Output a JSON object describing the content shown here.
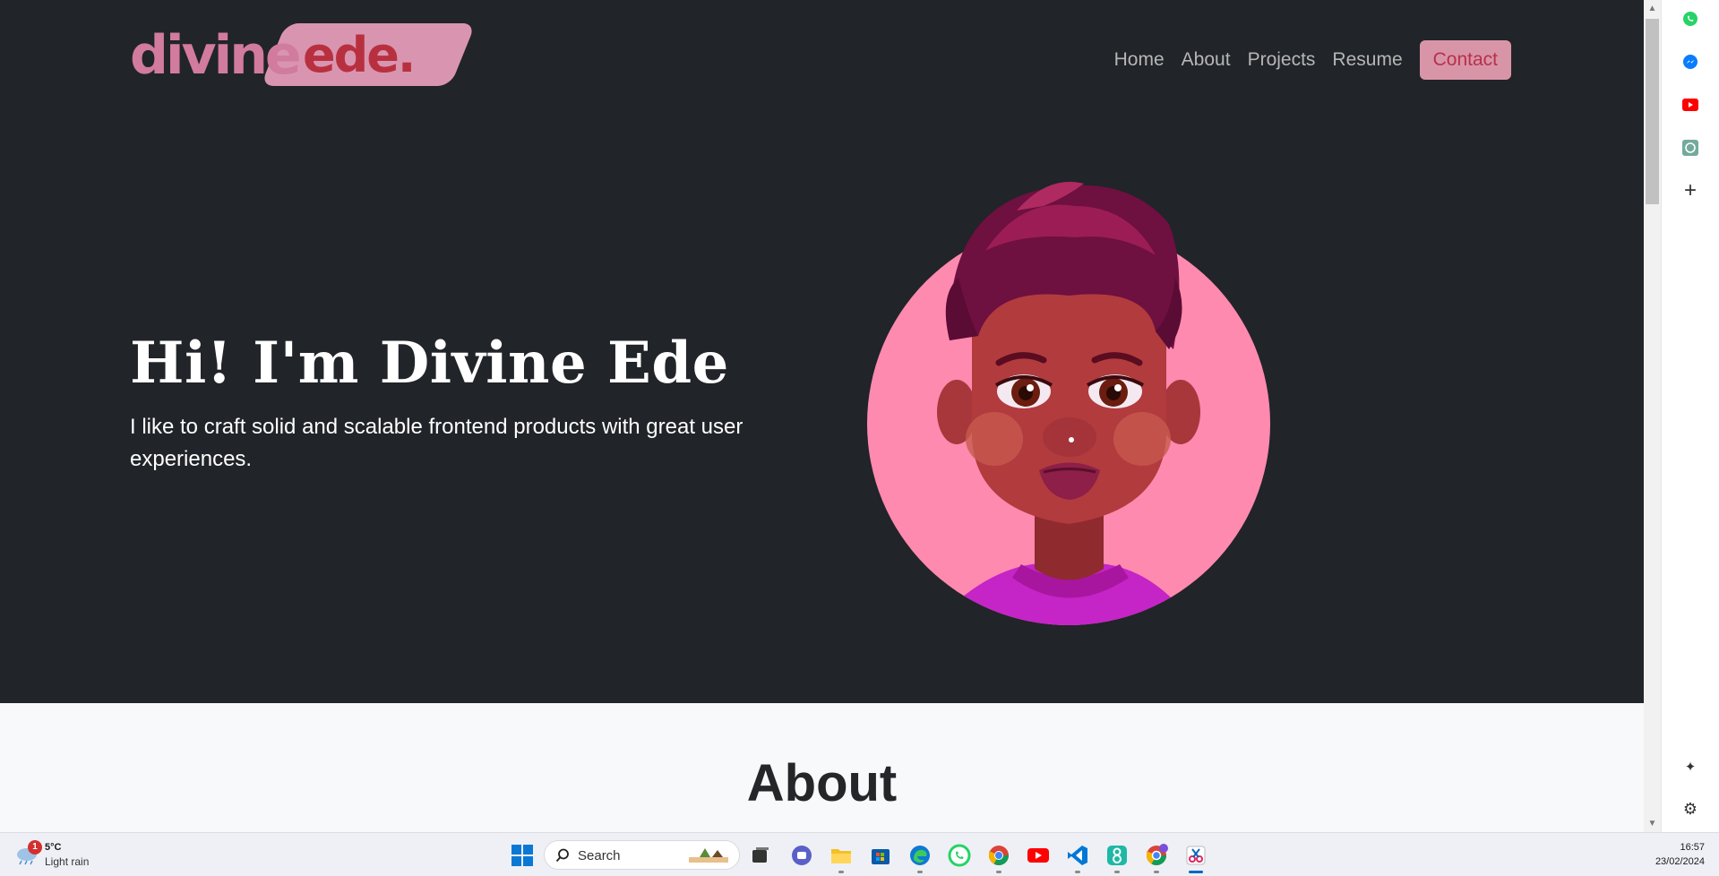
{
  "header": {
    "logo_part1": "divine",
    "logo_part2": "ede.",
    "nav": [
      "Home",
      "About",
      "Projects",
      "Resume"
    ],
    "contact_label": "Contact"
  },
  "hero": {
    "title": "Hi! I'm Divine Ede",
    "subtitle": "I like to craft solid and scalable frontend products with great user experiences."
  },
  "about": {
    "title": "About"
  },
  "colors": {
    "hero_bg": "#212428",
    "accent_pink": "#d995b0",
    "accent_red": "#b8303f",
    "avatar_circle": "#ff8aaf"
  },
  "edge_sidebar": {
    "icons": [
      "whatsapp-icon",
      "messenger-icon",
      "youtube-icon",
      "chatgpt-icon",
      "add-icon",
      "pin-icon",
      "settings-icon"
    ]
  },
  "taskbar": {
    "weather_temp": "5°C",
    "weather_condition": "Light rain",
    "weather_badge": "1",
    "search_placeholder": "Search",
    "apps": [
      "windows-start-icon",
      "task-view-icon",
      "teams-icon",
      "file-explorer-icon",
      "microsoft-store-icon",
      "edge-icon",
      "whatsapp-icon",
      "chrome-icon",
      "youtube-icon",
      "vscode-icon",
      "app-8-icon",
      "chrome-profile-icon",
      "snipping-tool-icon"
    ],
    "time": "16:57",
    "date": "23/02/2024"
  }
}
